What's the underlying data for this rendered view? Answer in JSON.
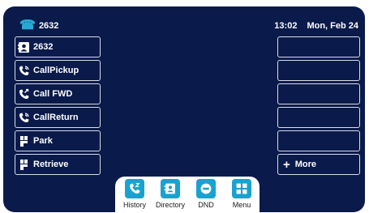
{
  "header": {
    "extension": "2632",
    "time": "13:02",
    "date": "Mon, Feb 24"
  },
  "line_keys": [
    {
      "label": "2632",
      "icon": "contact-card-icon"
    },
    {
      "label": "CallPickup",
      "icon": "handset-icon"
    },
    {
      "label": "Call FWD",
      "icon": "call-forward-icon"
    },
    {
      "label": "CallReturn",
      "icon": "handset-icon"
    },
    {
      "label": "Park",
      "icon": "park-icon"
    },
    {
      "label": "Retrieve",
      "icon": "park-icon"
    }
  ],
  "right_keys": [
    {
      "label": ""
    },
    {
      "label": ""
    },
    {
      "label": ""
    },
    {
      "label": ""
    },
    {
      "label": ""
    },
    {
      "label": "More",
      "icon": "plus-icon"
    }
  ],
  "softkeys": [
    {
      "label": "History",
      "icon": "history-icon"
    },
    {
      "label": "Directory",
      "icon": "directory-icon"
    },
    {
      "label": "DND",
      "icon": "dnd-icon"
    },
    {
      "label": "Menu",
      "icon": "menu-grid-icon"
    }
  ],
  "colors": {
    "background": "#0a1a4a",
    "accent": "#1aa2cf",
    "key_border": "#d8dde8"
  }
}
